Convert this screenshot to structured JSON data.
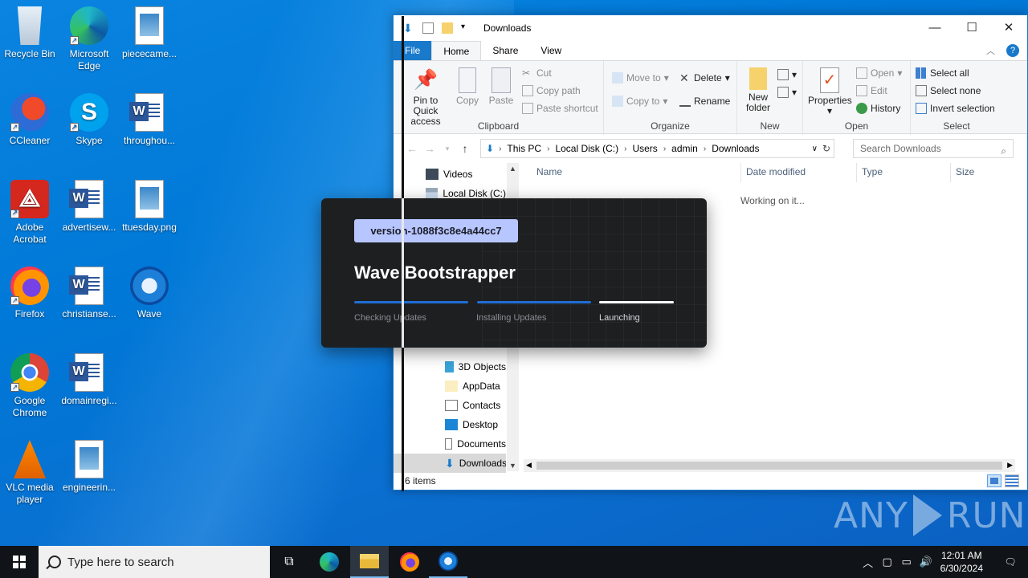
{
  "desktop": {
    "icons": [
      {
        "label": "Recycle Bin"
      },
      {
        "label": "Microsoft Edge"
      },
      {
        "label": "piececame..."
      },
      {
        "label": "CCleaner"
      },
      {
        "label": "Skype"
      },
      {
        "label": "throughou..."
      },
      {
        "label": "Adobe Acrobat"
      },
      {
        "label": "advertisew..."
      },
      {
        "label": "ttuesday.png"
      },
      {
        "label": "Firefox"
      },
      {
        "label": "christianse..."
      },
      {
        "label": "Wave"
      },
      {
        "label": "Google Chrome"
      },
      {
        "label": "domainregi..."
      },
      {
        "label": "VLC media player"
      },
      {
        "label": "engineerin..."
      }
    ]
  },
  "explorer": {
    "title": "Downloads",
    "tabs": [
      "File",
      "Home",
      "Share",
      "View"
    ],
    "ribbon": {
      "clipboard": {
        "label": "Clipboard",
        "pin": "Pin to Quick access",
        "copy": "Copy",
        "paste": "Paste",
        "cut": "Cut",
        "copy_path": "Copy path",
        "paste_shortcut": "Paste shortcut"
      },
      "organize": {
        "label": "Organize",
        "move_to": "Move to",
        "copy_to": "Copy to",
        "delete": "Delete",
        "rename": "Rename"
      },
      "new": {
        "label": "New",
        "new_folder": "New folder"
      },
      "open": {
        "label": "Open",
        "properties": "Properties",
        "open": "Open",
        "edit": "Edit",
        "history": "History"
      },
      "select": {
        "label": "Select",
        "select_all": "Select all",
        "select_none": "Select none",
        "invert": "Invert selection"
      }
    },
    "breadcrumbs": [
      "This PC",
      "Local Disk (C:)",
      "Users",
      "admin",
      "Downloads"
    ],
    "search_placeholder": "Search Downloads",
    "nav_items": [
      "Videos",
      "Local Disk (C:)",
      "3D Objects",
      "AppData",
      "Contacts",
      "Desktop",
      "Documents",
      "Downloads"
    ],
    "columns": [
      "Name",
      "Date modified",
      "Type",
      "Size"
    ],
    "loading_text": "Working on it...",
    "status": "6 items"
  },
  "bootstrapper": {
    "version": "version-1088f3c8e4a44cc7",
    "title": "Wave Bootstrapper",
    "steps": [
      {
        "label": "Checking Updates",
        "state": "done"
      },
      {
        "label": "Installing Updates",
        "state": "done"
      },
      {
        "label": "Launching",
        "state": "active"
      }
    ],
    "colors": {
      "done": "#1f6ed4",
      "active": "#ffffff",
      "badge": "#b8c6ff"
    }
  },
  "watermark": {
    "left": "ANY",
    "right": "RUN"
  },
  "taskbar": {
    "search_placeholder": "Type here to search",
    "time": "12:01 AM",
    "date": "6/30/2024"
  }
}
